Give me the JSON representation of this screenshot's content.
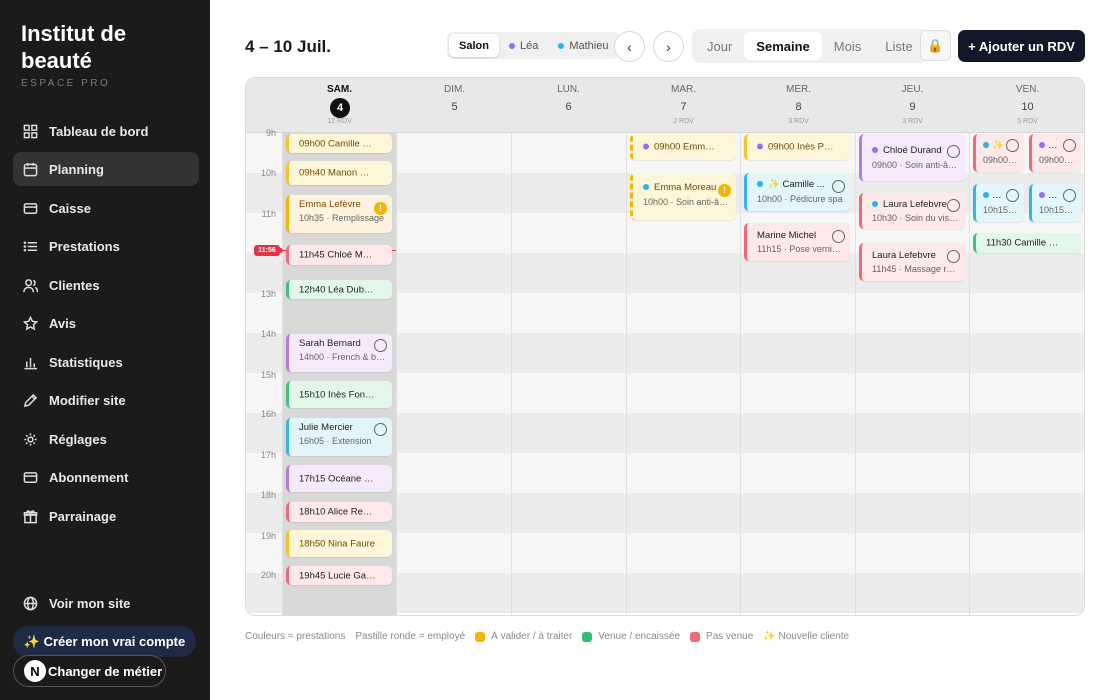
{
  "sidebar": {
    "brand": "Institut de beauté",
    "subtitle": "ESPACE PRO",
    "items": [
      {
        "label": "Tableau de bord",
        "icon": "dashboard-icon"
      },
      {
        "label": "Planning",
        "icon": "calendar-icon",
        "active": true
      },
      {
        "label": "Caisse",
        "icon": "card-icon"
      },
      {
        "label": "Prestations",
        "icon": "list-icon"
      },
      {
        "label": "Clientes",
        "icon": "users-icon"
      },
      {
        "label": "Avis",
        "icon": "star-icon"
      },
      {
        "label": "Statistiques",
        "icon": "chart-icon"
      },
      {
        "label": "Modifier site",
        "icon": "pen-icon"
      },
      {
        "label": "Réglages",
        "icon": "gear-icon"
      },
      {
        "label": "Abonnement",
        "icon": "card-icon"
      },
      {
        "label": "Parrainage",
        "icon": "gift-icon"
      }
    ],
    "view_site": "Voir mon site",
    "create_account": "✨ Créer mon vrai compte",
    "change_job": "Changer de métier",
    "change_job_logo": "N"
  },
  "toolbar": {
    "title": "4 – 10 Juil.",
    "staff_filter": [
      {
        "label": "Salon",
        "selected": true
      },
      {
        "label": "Léa",
        "color": "#9b6cf0"
      },
      {
        "label": "Mathieu",
        "color": "#2bb3e6"
      }
    ],
    "prev_label": "‹",
    "next_label": "›",
    "views": [
      "Jour",
      "Semaine",
      "Mois",
      "Liste"
    ],
    "selected_view": "Semaine",
    "lock_icon": "🔒",
    "add_label": "+ Ajouter un RDV"
  },
  "calendar": {
    "days": [
      {
        "name": "SAM.",
        "date": "4",
        "count": "12 RDV",
        "today": true
      },
      {
        "name": "DIM.",
        "date": "5",
        "count": ""
      },
      {
        "name": "LUN.",
        "date": "6",
        "count": ""
      },
      {
        "name": "MAR.",
        "date": "7",
        "count": "2 RDV"
      },
      {
        "name": "MER.",
        "date": "8",
        "count": "3 RDV"
      },
      {
        "name": "JEU.",
        "date": "9",
        "count": "3 RDV"
      },
      {
        "name": "VEN.",
        "date": "10",
        "count": "5 RDV"
      }
    ],
    "hours": [
      "9h",
      "10h",
      "11h",
      "12h",
      "13h",
      "14h",
      "15h",
      "16h",
      "17h",
      "18h",
      "19h",
      "20h"
    ],
    "now_label": "11:56"
  },
  "legend": {
    "prestations": "Couleurs = prestations",
    "employe": "Pastille ronde = employé",
    "a_valider": "À valider / à traiter",
    "a_valider_color": "#f5b400",
    "venue": "Venue / encaissée",
    "venue_color": "#2fbf6f",
    "pas_venue": "Pas venue",
    "pas_venue_color": "#ee6b74",
    "nouvelle": "✨ Nouvelle cliente"
  },
  "events": {
    "sat": [
      {
        "title": "09h00 Camille Rou..."
      },
      {
        "title": "09h40 Manon Girard"
      },
      {
        "title": "Emma Lefèvre",
        "sub": "10h35 · Remplissage"
      },
      {
        "title": "11h45 Chloé Moreau"
      },
      {
        "title": "12h40 Léa Dubois"
      },
      {
        "title": "Sarah Bernard",
        "sub": "14h00 · French & ba..."
      },
      {
        "title": "15h10 Inès Fontaine"
      },
      {
        "title": "Julie Mercier",
        "sub": "16h05 · Extension"
      },
      {
        "title": "17h15 Océane Blanc"
      },
      {
        "title": "18h10 Alice Renard"
      },
      {
        "title": "18h50 Nina Faure"
      },
      {
        "title": "19h45 Lucie Garnier"
      }
    ],
    "tue": [
      {
        "title": "09h00 Emma Mo..."
      },
      {
        "title": "Emma Moreau",
        "sub": "10h00 · Soin anti-âg..."
      }
    ],
    "wed": [
      {
        "title": "09h00 Inès Petit"
      },
      {
        "title": "✨ Camille ...",
        "sub": "10h00 · Pédicure spa"
      },
      {
        "title": "Marine Michel",
        "sub": "11h15 · Pose vernis ..."
      }
    ],
    "thu": [
      {
        "title": "Chloé Durand",
        "sub": "09h00 · Soin anti-âg..."
      },
      {
        "title": "Laura Lefebvre",
        "sub": "10h30 · Soin du visa..."
      },
      {
        "title": "Laura Lefebvre",
        "sub": "11h45 · Massage rel..."
      }
    ],
    "fri": [
      {
        "title": "✨",
        "sub": "09h00 ·..."
      },
      {
        "title": "L...",
        "sub": "09h00 ·..."
      },
      {
        "title": "L...",
        "sub": "10h15 ·..."
      },
      {
        "title": "A...",
        "sub": "10h15 ·..."
      },
      {
        "title": "11h30 Camille Martin"
      }
    ]
  }
}
